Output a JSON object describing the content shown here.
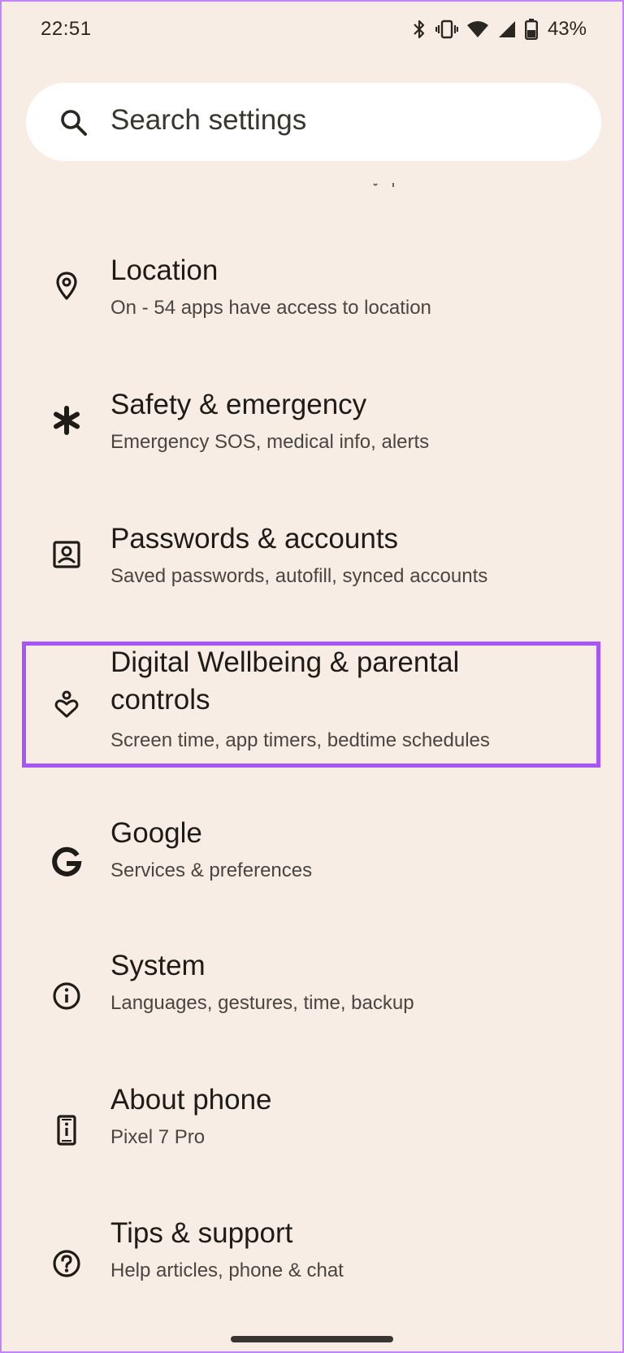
{
  "status_bar": {
    "time": "22:51",
    "battery_percent": "43%",
    "icons": [
      "bluetooth-icon",
      "vibrate-icon",
      "wifi-icon",
      "cell-signal-icon",
      "battery-icon"
    ]
  },
  "search": {
    "placeholder": "Search settings",
    "icon": "search-icon"
  },
  "colors": {
    "background": "#f8ede4",
    "search_bg": "#ffffff",
    "highlight": "#a855f7",
    "text_primary": "#1f1b17",
    "text_secondary": "#4a4540"
  },
  "settings": {
    "items": [
      {
        "title": "Location",
        "subtitle": "On - 54 apps have access to location",
        "icon": "location-pin-icon"
      },
      {
        "title": "Safety & emergency",
        "subtitle": "Emergency SOS, medical info, alerts",
        "icon": "asterisk-icon"
      },
      {
        "title": "Passwords & accounts",
        "subtitle": "Saved passwords, autofill, synced accounts",
        "icon": "account-box-icon"
      },
      {
        "title": "Digital Wellbeing & parental controls",
        "subtitle": "Screen time, app timers, bedtime schedules",
        "icon": "wellbeing-heart-icon",
        "highlighted": true
      },
      {
        "title": "Google",
        "subtitle": "Services & preferences",
        "icon": "google-g-icon"
      },
      {
        "title": "System",
        "subtitle": "Languages, gestures, time, backup",
        "icon": "info-circle-icon"
      },
      {
        "title": "About phone",
        "subtitle": "Pixel 7 Pro",
        "icon": "phone-info-icon"
      },
      {
        "title": "Tips & support",
        "subtitle": "Help articles, phone & chat",
        "icon": "help-circle-icon"
      }
    ]
  }
}
